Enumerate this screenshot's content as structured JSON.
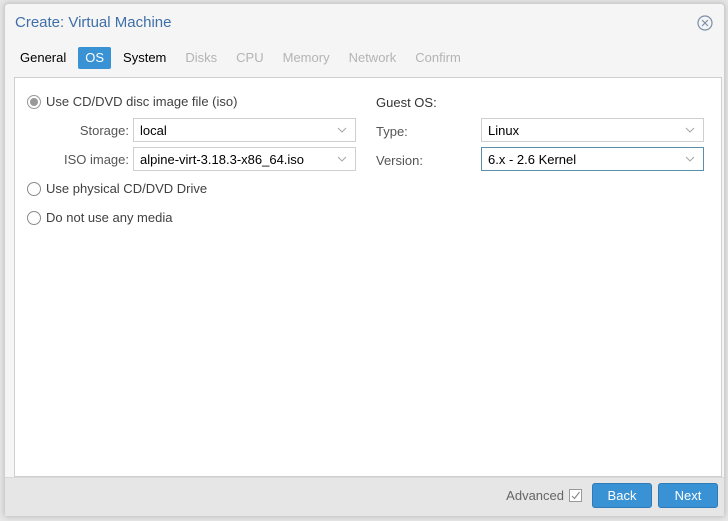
{
  "dialog": {
    "title": "Create: Virtual Machine",
    "close_icon": "close-circle-icon"
  },
  "tabs": [
    {
      "label": "General",
      "state": "enabled"
    },
    {
      "label": "OS",
      "state": "active"
    },
    {
      "label": "System",
      "state": "enabled"
    },
    {
      "label": "Disks",
      "state": "disabled"
    },
    {
      "label": "CPU",
      "state": "disabled"
    },
    {
      "label": "Memory",
      "state": "disabled"
    },
    {
      "label": "Network",
      "state": "disabled"
    },
    {
      "label": "Confirm",
      "state": "disabled"
    }
  ],
  "media": {
    "options": [
      {
        "label": "Use CD/DVD disc image file (iso)",
        "checked": true
      },
      {
        "label": "Use physical CD/DVD Drive",
        "checked": false
      },
      {
        "label": "Do not use any media",
        "checked": false
      }
    ],
    "storage_label": "Storage:",
    "storage_value": "local",
    "iso_label": "ISO image:",
    "iso_value": "alpine-virt-3.18.3-x86_64.iso"
  },
  "guest_os": {
    "heading": "Guest OS:",
    "type_label": "Type:",
    "type_value": "Linux",
    "version_label": "Version:",
    "version_value": "6.x - 2.6 Kernel"
  },
  "footer": {
    "advanced_label": "Advanced",
    "advanced_checked": true,
    "back_label": "Back",
    "next_label": "Next"
  },
  "colors": {
    "accent": "#3892d4",
    "title": "#3f6fa8",
    "disabled_tab": "#b4b4b4"
  }
}
